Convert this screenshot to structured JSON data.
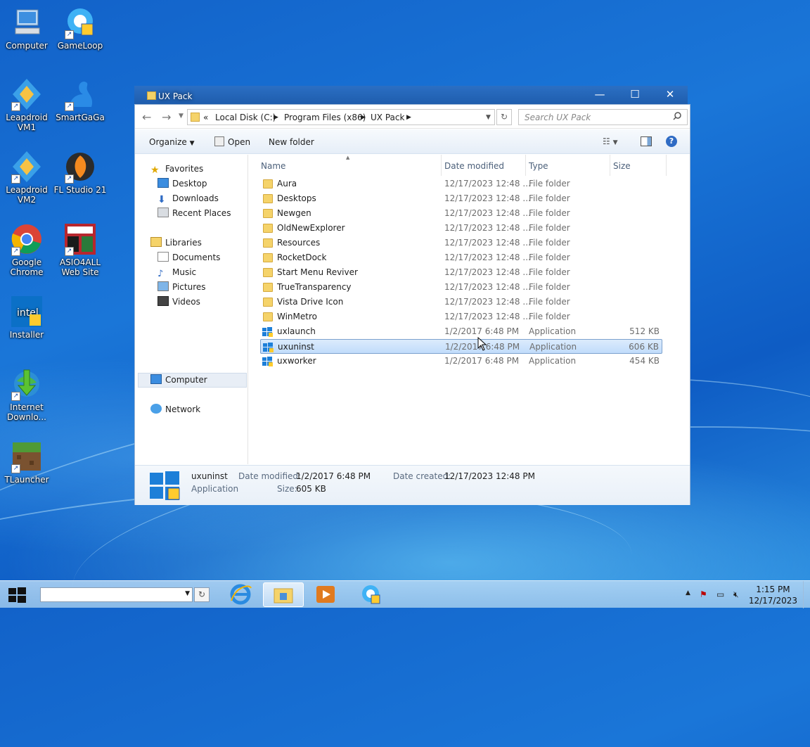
{
  "desktop": {
    "icons": [
      {
        "label": "Computer"
      },
      {
        "label": "GameLoop"
      },
      {
        "label": "Leapdroid VM1"
      },
      {
        "label": "SmartGaGa"
      },
      {
        "label": "Leapdroid VM2"
      },
      {
        "label": "FL Studio 21"
      },
      {
        "label": "Google Chrome"
      },
      {
        "label": "ASIO4ALL Web Site"
      },
      {
        "label": "Installer"
      },
      {
        "label": "Internet Downlo..."
      },
      {
        "label": "TLauncher"
      }
    ]
  },
  "window": {
    "title": "UX Pack",
    "minimize": "—",
    "maximize": "☐",
    "close": "✕",
    "breadcrumb": {
      "overflow": "«",
      "items": [
        "Local Disk (C:)",
        "Program Files (x86)",
        "UX Pack"
      ]
    },
    "search_placeholder": "Search UX Pack",
    "toolbar": {
      "organize": "Organize",
      "open": "Open",
      "new_folder": "New folder"
    },
    "nav": {
      "favorites": "Favorites",
      "favorite_items": [
        "Desktop",
        "Downloads",
        "Recent Places"
      ],
      "libraries": "Libraries",
      "library_items": [
        "Documents",
        "Music",
        "Pictures",
        "Videos"
      ],
      "computer": "Computer",
      "network": "Network"
    },
    "columns": {
      "name": "Name",
      "date": "Date modified",
      "type": "Type",
      "size": "Size"
    },
    "files": [
      {
        "name": "Aura",
        "date": "12/17/2023 12:48 ...",
        "type": "File folder",
        "size": ""
      },
      {
        "name": "Desktops",
        "date": "12/17/2023 12:48 ...",
        "type": "File folder",
        "size": ""
      },
      {
        "name": "Newgen",
        "date": "12/17/2023 12:48 ...",
        "type": "File folder",
        "size": ""
      },
      {
        "name": "OldNewExplorer",
        "date": "12/17/2023 12:48 ...",
        "type": "File folder",
        "size": ""
      },
      {
        "name": "Resources",
        "date": "12/17/2023 12:48 ...",
        "type": "File folder",
        "size": ""
      },
      {
        "name": "RocketDock",
        "date": "12/17/2023 12:48 ...",
        "type": "File folder",
        "size": ""
      },
      {
        "name": "Start Menu Reviver",
        "date": "12/17/2023 12:48 ...",
        "type": "File folder",
        "size": ""
      },
      {
        "name": "TrueTransparency",
        "date": "12/17/2023 12:48 ...",
        "type": "File folder",
        "size": ""
      },
      {
        "name": "Vista Drive Icon",
        "date": "12/17/2023 12:48 ...",
        "type": "File folder",
        "size": ""
      },
      {
        "name": "WinMetro",
        "date": "12/17/2023 12:48 ...",
        "type": "File folder",
        "size": ""
      },
      {
        "name": "uxlaunch",
        "date": "1/2/2017 6:48 PM",
        "type": "Application",
        "size": "512 KB"
      },
      {
        "name": "uxuninst",
        "date": "1/2/2017 6:48 PM",
        "type": "Application",
        "size": "606 KB"
      },
      {
        "name": "uxworker",
        "date": "1/2/2017 6:48 PM",
        "type": "Application",
        "size": "454 KB"
      }
    ],
    "selected_file": "uxuninst",
    "details": {
      "name": "uxuninst",
      "kind": "Application",
      "date_modified_label": "Date modified:",
      "date_modified": "1/2/2017 6:48 PM",
      "size_label": "Size:",
      "size": "605 KB",
      "date_created_label": "Date created:",
      "date_created": "12/17/2023 12:48 PM"
    }
  },
  "taskbar": {
    "time": "1:15 PM",
    "date": "12/17/2023",
    "address_value": ""
  },
  "colors": {
    "accent": "#1e5aa8",
    "selection": "#c1dcfb",
    "folder": "#f5d36a"
  }
}
